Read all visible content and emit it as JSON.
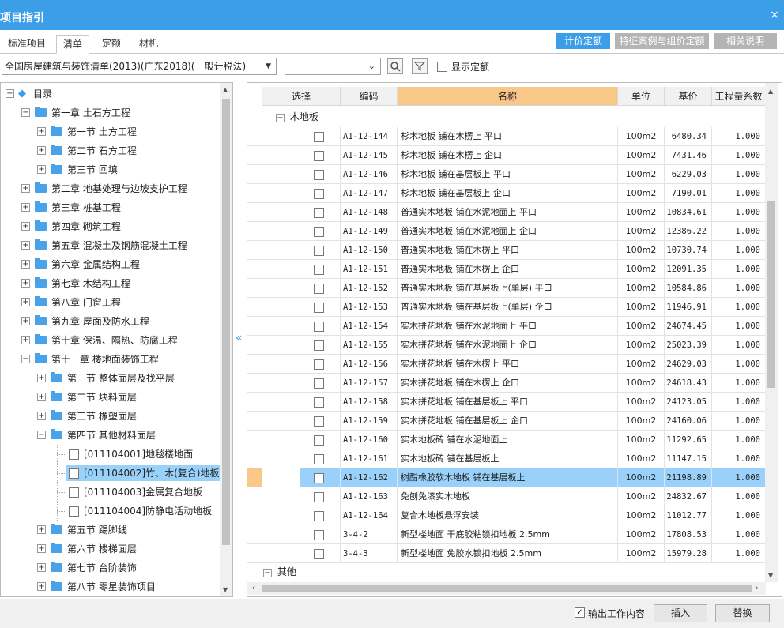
{
  "window": {
    "title": "项目指引",
    "close": "×"
  },
  "tabs": [
    "标准项目",
    "清单",
    "定额",
    "材机"
  ],
  "right_buttons": [
    "计价定额",
    "特征案例与组价定额",
    "相关说明"
  ],
  "toolbar": {
    "library_select": "全国房屋建筑与装饰清单(2013)(广东2018)(一般计税法)",
    "search_value": "",
    "show_quota_label": "显示定额"
  },
  "tree": {
    "root": "目录",
    "chapters": [
      {
        "label": "第一章  土石方工程",
        "expanded": true,
        "sections": [
          {
            "label": "第一节  土方工程"
          },
          {
            "label": "第二节  石方工程"
          },
          {
            "label": "第三节  回填"
          }
        ]
      },
      {
        "label": "第二章  地基处理与边坡支护工程"
      },
      {
        "label": "第三章  桩基工程"
      },
      {
        "label": "第四章  砌筑工程"
      },
      {
        "label": "第五章  混凝土及钢筋混凝土工程"
      },
      {
        "label": "第六章  金属结构工程"
      },
      {
        "label": "第七章  木结构工程"
      },
      {
        "label": "第八章  门窗工程"
      },
      {
        "label": "第九章  屋面及防水工程"
      },
      {
        "label": "第十章  保温、隔热、防腐工程"
      },
      {
        "label": "第十一章  楼地面装饰工程",
        "expanded": true,
        "sections": [
          {
            "label": "第一节  整体面层及找平层"
          },
          {
            "label": "第二节  块料面层"
          },
          {
            "label": "第三节  橡塑面层"
          },
          {
            "label": "第四节  其他材料面层",
            "expanded": true,
            "items": [
              "[011104001]地毯楼地面",
              "[011104002]竹、木(复合)地板",
              "[011104003]金属复合地板",
              "[011104004]防静电活动地板"
            ]
          },
          {
            "label": "第五节  踢脚线"
          },
          {
            "label": "第六节  楼梯面层"
          },
          {
            "label": "第七节  台阶装饰"
          },
          {
            "label": "第八节  零星装饰项目"
          }
        ]
      }
    ],
    "selected_item": "[011104002]竹、木(复合)地板"
  },
  "grid": {
    "columns": [
      "选择",
      "编码",
      "名称",
      "单位",
      "基价",
      "工程量系数"
    ],
    "group_label": "木地板",
    "rows": [
      {
        "code": "A1-12-144",
        "name": "杉木地板 铺在木楞上 平口",
        "unit": "100m2",
        "price": "6480.34",
        "factor": "1.000"
      },
      {
        "code": "A1-12-145",
        "name": "杉木地板 铺在木楞上 企口",
        "unit": "100m2",
        "price": "7431.46",
        "factor": "1.000"
      },
      {
        "code": "A1-12-146",
        "name": "杉木地板 铺在基层板上 平口",
        "unit": "100m2",
        "price": "6229.03",
        "factor": "1.000"
      },
      {
        "code": "A1-12-147",
        "name": "杉木地板 铺在基层板上 企口",
        "unit": "100m2",
        "price": "7190.01",
        "factor": "1.000"
      },
      {
        "code": "A1-12-148",
        "name": "普通实木地板 铺在水泥地面上 平口",
        "unit": "100m2",
        "price": "10834.61",
        "factor": "1.000"
      },
      {
        "code": "A1-12-149",
        "name": "普通实木地板 铺在水泥地面上 企口",
        "unit": "100m2",
        "price": "12386.22",
        "factor": "1.000"
      },
      {
        "code": "A1-12-150",
        "name": "普通实木地板 铺在木楞上 平口",
        "unit": "100m2",
        "price": "10730.74",
        "factor": "1.000"
      },
      {
        "code": "A1-12-151",
        "name": "普通实木地板 铺在木楞上 企口",
        "unit": "100m2",
        "price": "12091.35",
        "factor": "1.000"
      },
      {
        "code": "A1-12-152",
        "name": "普通实木地板 铺在基层板上(单层) 平口",
        "unit": "100m2",
        "price": "10584.86",
        "factor": "1.000"
      },
      {
        "code": "A1-12-153",
        "name": "普通实木地板 铺在基层板上(单层) 企口",
        "unit": "100m2",
        "price": "11946.91",
        "factor": "1.000"
      },
      {
        "code": "A1-12-154",
        "name": "实木拼花地板 铺在水泥地面上 平口",
        "unit": "100m2",
        "price": "24674.45",
        "factor": "1.000"
      },
      {
        "code": "A1-12-155",
        "name": "实木拼花地板 铺在水泥地面上 企口",
        "unit": "100m2",
        "price": "25023.39",
        "factor": "1.000"
      },
      {
        "code": "A1-12-156",
        "name": "实木拼花地板 铺在木楞上 平口",
        "unit": "100m2",
        "price": "24629.03",
        "factor": "1.000"
      },
      {
        "code": "A1-12-157",
        "name": "实木拼花地板 铺在木楞上 企口",
        "unit": "100m2",
        "price": "24618.43",
        "factor": "1.000"
      },
      {
        "code": "A1-12-158",
        "name": "实木拼花地板 铺在基层板上 平口",
        "unit": "100m2",
        "price": "24123.05",
        "factor": "1.000"
      },
      {
        "code": "A1-12-159",
        "name": "实木拼花地板 铺在基层板上 企口",
        "unit": "100m2",
        "price": "24160.06",
        "factor": "1.000"
      },
      {
        "code": "A1-12-160",
        "name": "实木地板砖 铺在水泥地面上",
        "unit": "100m2",
        "price": "11292.65",
        "factor": "1.000"
      },
      {
        "code": "A1-12-161",
        "name": "实木地板砖 铺在基层板上",
        "unit": "100m2",
        "price": "11147.15",
        "factor": "1.000"
      },
      {
        "code": "A1-12-162",
        "name": "树酯橡胶软木地板 铺在基层板上",
        "unit": "100m2",
        "price": "21198.89",
        "factor": "1.000",
        "selected": true
      },
      {
        "code": "A1-12-163",
        "name": "免刨免漆实木地板",
        "unit": "100m2",
        "price": "24832.67",
        "factor": "1.000"
      },
      {
        "code": "A1-12-164",
        "name": "复合木地板悬浮安装",
        "unit": "100m2",
        "price": "11012.77",
        "factor": "1.000"
      },
      {
        "code": "3-4-2",
        "name": "新型楼地面 干底胶粘锁扣地板 2.5mm",
        "unit": "100m2",
        "price": "17808.53",
        "factor": "1.000"
      },
      {
        "code": "3-4-3",
        "name": "新型楼地面 免胶水锁扣地板 2.5mm",
        "unit": "100m2",
        "price": "15979.28",
        "factor": "1.000"
      }
    ],
    "other_group_label": "其他"
  },
  "footer": {
    "output_work_label": "输出工作内容",
    "insert": "插入",
    "replace": "替换"
  },
  "colors": {
    "titlebar": "#3d9ee8",
    "active_button": "#3d9ee8",
    "header_highlight": "#f9c889",
    "row_selected": "#99d1fa"
  }
}
